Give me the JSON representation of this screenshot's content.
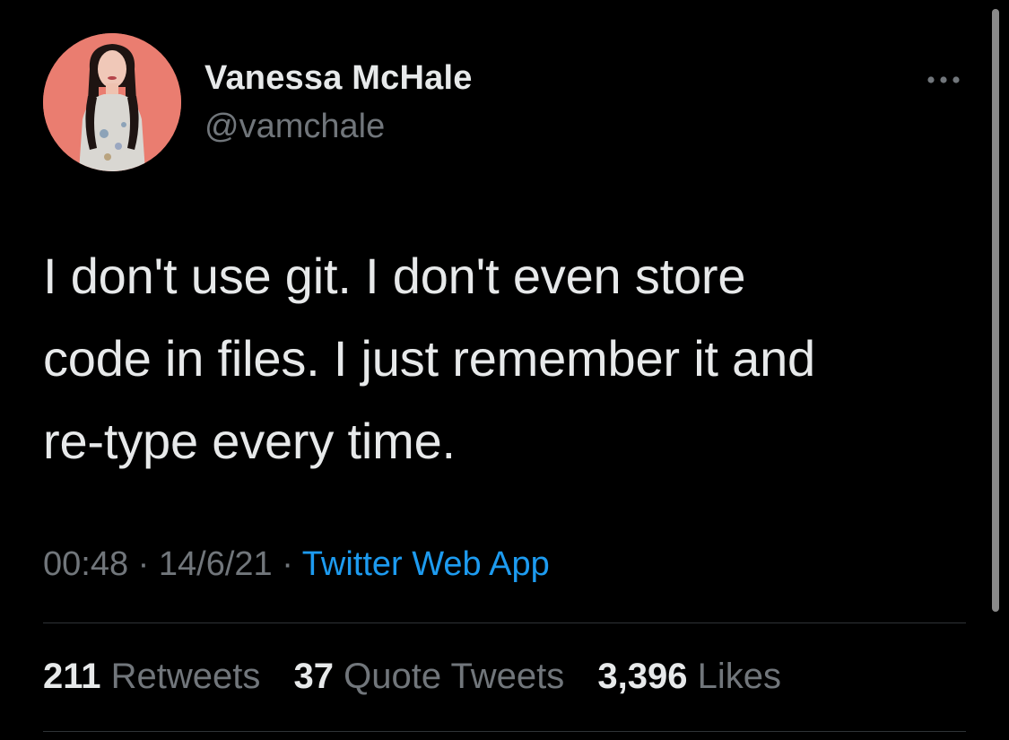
{
  "author": {
    "display_name": "Vanessa McHale",
    "handle": "@vamchale",
    "avatar_icon": "profile-photo"
  },
  "more_icon": "more-horizontal-icon",
  "tweet": {
    "lines": [
      "I don't use git. I don't even store",
      "code in files. I just remember it and",
      "re-type every time."
    ]
  },
  "meta": {
    "time": "00:48",
    "separator": "·",
    "date": "14/6/21",
    "source": "Twitter Web App"
  },
  "stats": {
    "retweets_count": "211",
    "retweets_label": "Retweets",
    "quotes_count": "37",
    "quotes_label": "Quote Tweets",
    "likes_count": "3,396",
    "likes_label": "Likes"
  },
  "colors": {
    "background": "#000000",
    "text": "#e7e9ea",
    "secondary": "#71767b",
    "link": "#1d9bf0",
    "divider": "#2f3336"
  }
}
